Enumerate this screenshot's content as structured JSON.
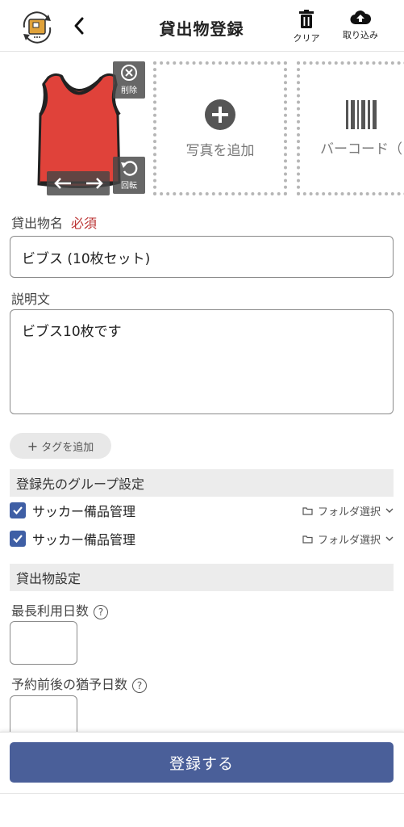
{
  "header": {
    "title": "貸出物登録",
    "clear_label": "クリア",
    "import_label": "取り込み"
  },
  "photos": {
    "delete_label": "削除",
    "rotate_label": "回転",
    "add_photo_label": "写真を追加",
    "barcode_label": "バーコード（"
  },
  "form": {
    "name_label": "貸出物名",
    "required_label": "必須",
    "name_value": "ビブス (10枚セット)",
    "description_label": "説明文",
    "description_value": "ビブス10枚です",
    "add_tag_label": "タグを追加"
  },
  "groups": {
    "section_title": "登録先のグループ設定",
    "items": [
      {
        "name": "サッカー備品管理",
        "folder_label": "フォルダ選択"
      },
      {
        "name": "サッカー備品管理",
        "folder_label": "フォルダ選択"
      }
    ]
  },
  "loan_settings": {
    "section_title": "貸出物設定",
    "max_days_label": "最長利用日数",
    "grace_days_label": "予約前後の猶予日数",
    "help_glyph": "?"
  },
  "submit_label": "登録する",
  "colors": {
    "accent": "#4a5f99",
    "checkbox": "#3f5fa5",
    "required": "#bb3333",
    "bib": "#e0423a"
  }
}
